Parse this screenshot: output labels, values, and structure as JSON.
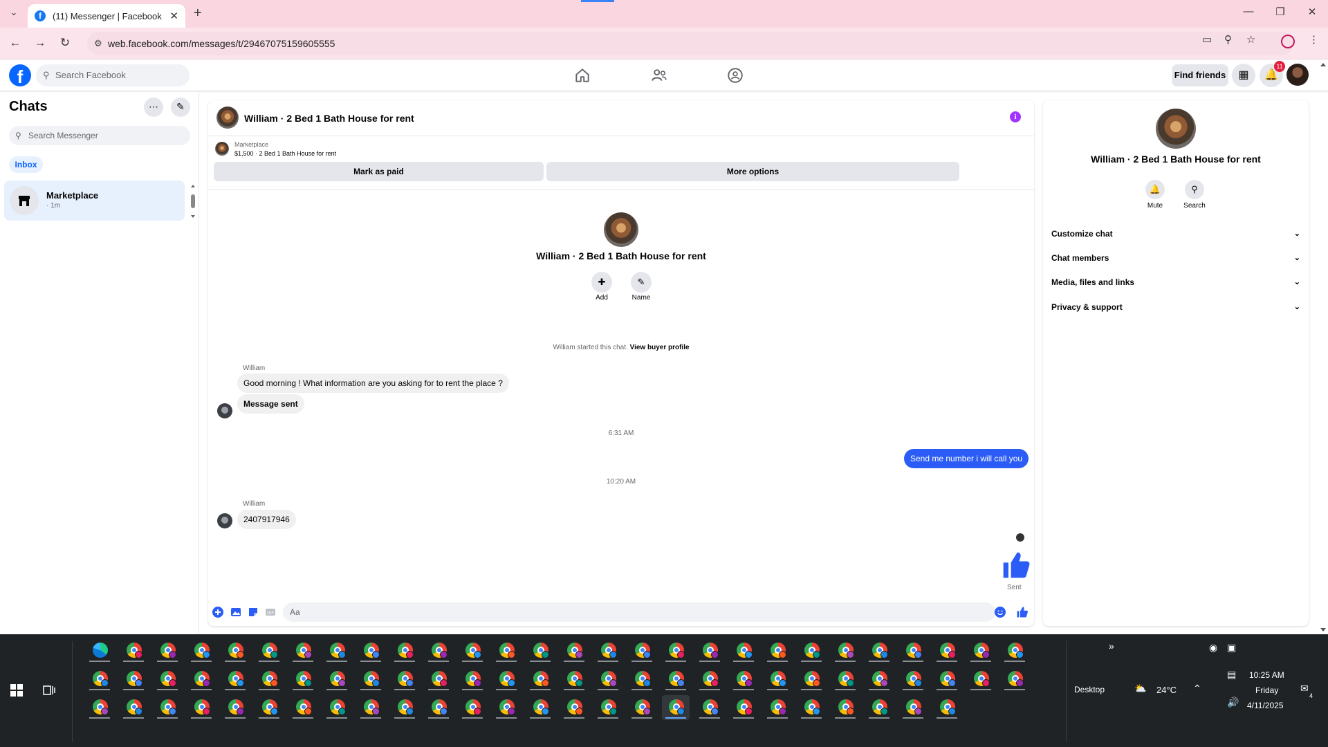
{
  "browser": {
    "tab_title": "(11) Messenger | Facebook",
    "url": "web.facebook.com/messages/t/29467075159605555",
    "accent_color": "#f9d6e0"
  },
  "fb_header": {
    "search_placeholder": "Search Facebook",
    "find_friends_label": "Find friends",
    "notification_count": "11"
  },
  "chats": {
    "title": "Chats",
    "search_placeholder": "Search Messenger",
    "filter_label": "Inbox",
    "items": [
      {
        "name": "Marketplace",
        "meta": "· 1m"
      }
    ]
  },
  "conversation": {
    "title": "William · 2 Bed 1 Bath House for rent",
    "marketplace_label": "Marketplace",
    "listing_summary": "$1,500 · 2 Bed 1 Bath House for rent",
    "mark_paid_label": "Mark as paid",
    "more_options_label": "More options",
    "actions": {
      "add_label": "Add",
      "name_label": "Name"
    },
    "system_note": "William started this chat.",
    "view_buyer_label": "View buyer profile",
    "sender_name": "William",
    "messages": [
      {
        "text": "Good morning ! What information are you asking for to rent the place ?"
      },
      {
        "text": "Message sent"
      },
      {
        "text": "Send me number i will call you"
      },
      {
        "text": "2407917946"
      }
    ],
    "timestamps": [
      "6:31 AM",
      "10:20 AM"
    ],
    "sent_label": "Sent",
    "composer_placeholder": "Aa",
    "accent_color": "#2b5cf6"
  },
  "info_panel": {
    "title": "William · 2 Bed 1 Bath House for rent",
    "mute_label": "Mute",
    "search_label": "Search",
    "sections": [
      "Customize chat",
      "Chat members",
      "Media, files and links",
      "Privacy & support"
    ]
  },
  "taskbar": {
    "desktop_label": "Desktop",
    "temperature": "24°C",
    "time": "10:25 AM",
    "day": "Friday",
    "date": "4/11/2025",
    "notification_count": "4"
  }
}
